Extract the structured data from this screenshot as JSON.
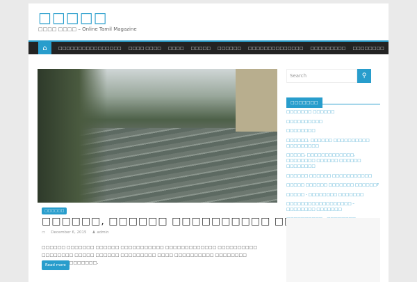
{
  "site": {
    "title": "□□□□□",
    "tagline": "□□□□ □□□□ – Online Tamil Magazine"
  },
  "nav": {
    "items": [
      "□□□□□□□□□□□□□□□□",
      "□□□□ □□□□",
      "□□□□",
      "□□□□□",
      "□□□□□□",
      "□□□□□□□□□□□□□□",
      "□□□□□□□□□",
      "□□□□□□□□"
    ]
  },
  "post": {
    "category": "□□□□□□",
    "title": "□□□□□□, □□□□□□ □□□□□□□□□□ □□□□□□□□□",
    "date": "December 6, 2015",
    "author": "admin",
    "excerpt": "□□□□□□ □□□□□□□ □□□□□□ □□□□□□□□□□□ □□□□□□□□□□□□□ □□□□□□□□□□ □□□□□□□□ □□□□□ □□□□□□ □□□□□□□□□ □□□□ □□□□□□□□□□ □□□□□□□□ □□□□□□□□□□□□□□.",
    "read_more": "Read more"
  },
  "sidebar": {
    "search_placeholder": "Search",
    "widget_title": "□□□□□□□",
    "links": [
      "□□□□□□□ □□□□□□",
      "□□□□□□□□□□",
      "□□□□□□□□",
      "□□□□□□, □□□□□□ □□□□□□□□□□ □□□□□□□□□",
      "□□□□□, □□□□□□□□□□□□□, □□□□□□□□ □□□□□□ □□□□□□ □□□□□□□□",
      "□□□□□□ □□□□□□ □□□□□□□□□□□",
      "□□□□□ □□□□□□ □□□□□□□ □□□□□□?",
      "□□□□□ - □□□□□□□□ □□□□□□□",
      "□□□□□□□□□□□□□□□□□□ – □□□□□□□□ □□□□□□□",
      "□□□□□□□□□□ – □□□□□□□□ □□□□□□□"
    ]
  }
}
